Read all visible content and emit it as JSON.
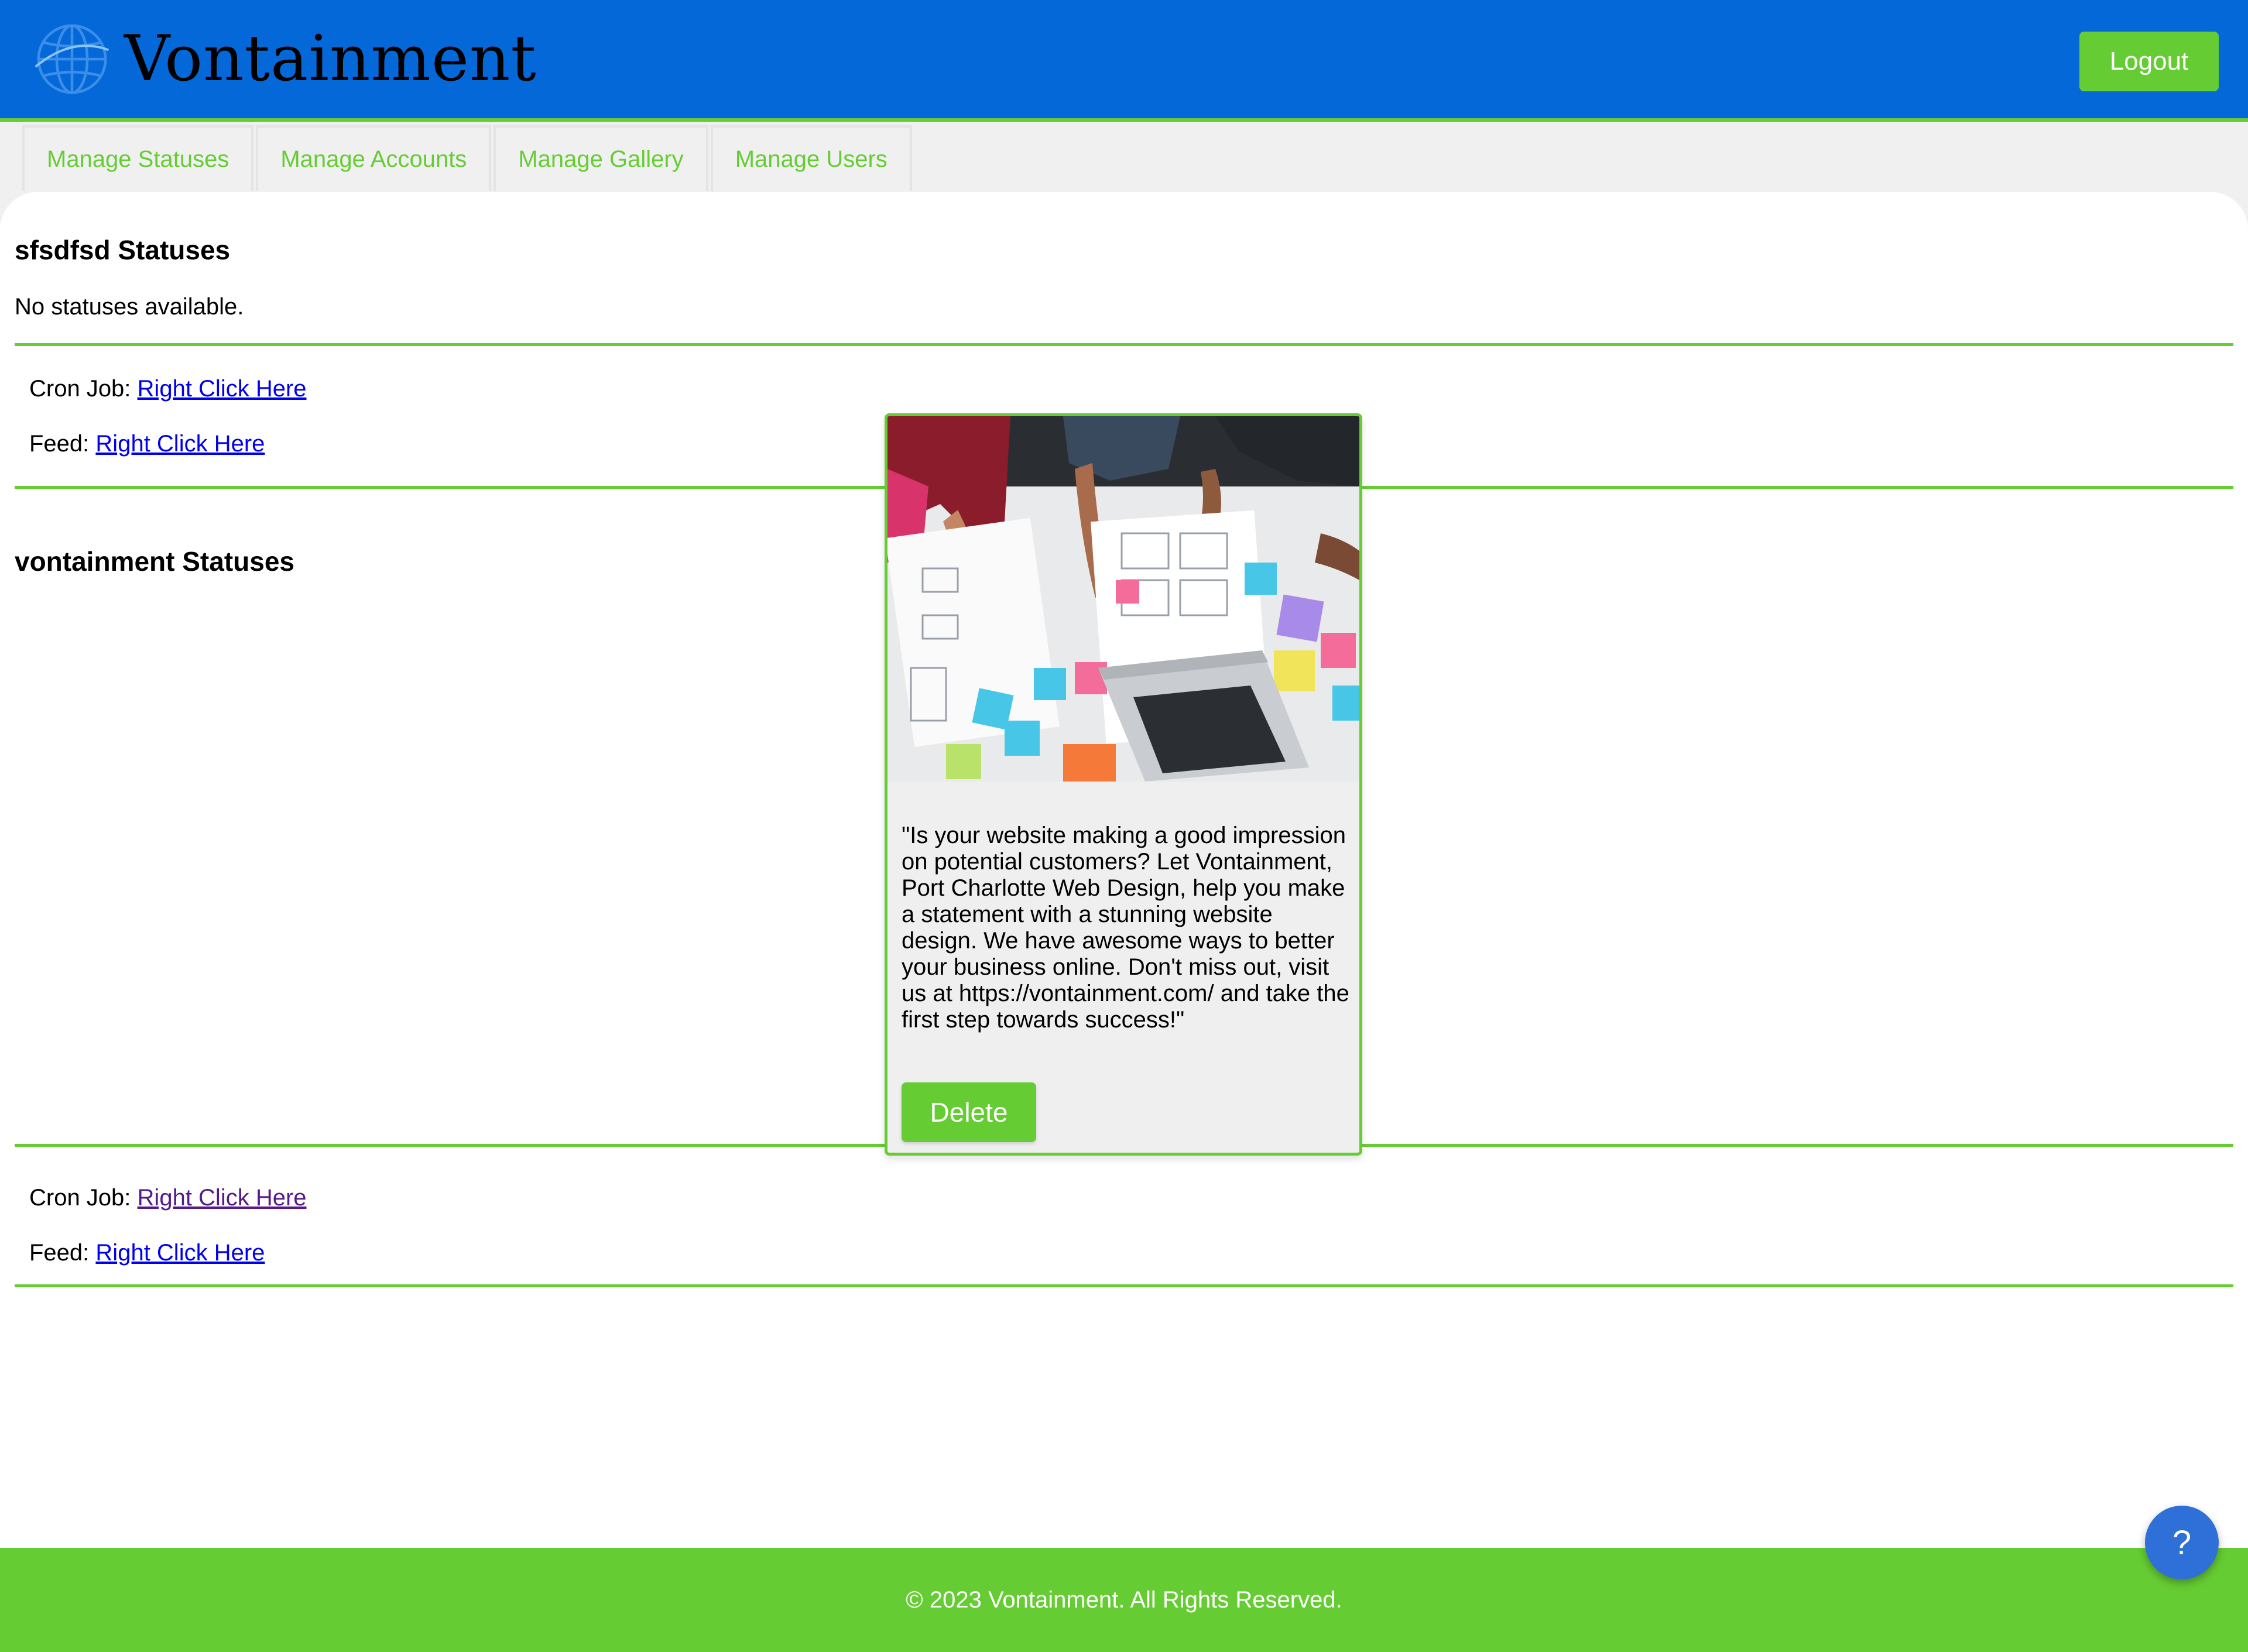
{
  "header": {
    "brand": "Vontainment",
    "logo_icon": "globe-icon",
    "logout_label": "Logout"
  },
  "nav": {
    "tabs": [
      {
        "label": "Manage Statuses"
      },
      {
        "label": "Manage Accounts"
      },
      {
        "label": "Manage Gallery"
      },
      {
        "label": "Manage Users"
      }
    ]
  },
  "accounts": [
    {
      "title": "sfsdfsd Statuses",
      "empty_message": "No statuses available.",
      "cron_label": "Cron Job:",
      "cron_link": "Right Click Here",
      "feed_label": "Feed:",
      "feed_link": "Right Click Here"
    },
    {
      "title": "vontainment Statuses",
      "status": {
        "text": "\"Is your website making a good impression on potential customers? Let Vontainment, Port Charlotte Web Design, help you make a statement with a stunning website design. We have awesome ways to better your business online. Don't miss out, visit us at https://vontainment.com/ and take the first step towards success!\"",
        "delete_label": "Delete"
      },
      "cron_label": "Cron Job:",
      "cron_link": "Right Click Here",
      "feed_label": "Feed:",
      "feed_link": "Right Click Here"
    }
  ],
  "footer": {
    "copyright": "© 2023 Vontainment. All Rights Reserved."
  },
  "help": {
    "label": "?"
  },
  "colors": {
    "header_blue": "#0568d8",
    "accent_green": "#66cc33",
    "link_blue": "#0000ee",
    "link_visited": "#551a8b",
    "help_blue": "#2e6fd8"
  }
}
